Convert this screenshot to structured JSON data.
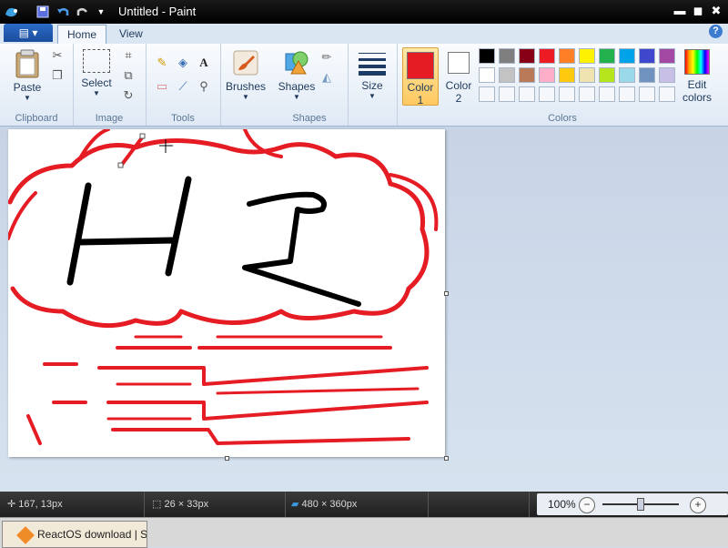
{
  "window": {
    "title": "Untitled - Paint"
  },
  "titlebar_icons": [
    "paint-app-icon",
    "save-icon",
    "undo-icon",
    "redo-icon",
    "quick-access-dropdown-icon"
  ],
  "tabs": [
    {
      "label": "Home"
    },
    {
      "label": "View"
    }
  ],
  "help": "?",
  "groups": {
    "clipboard": {
      "label": "Clipboard",
      "paste": "Paste"
    },
    "image": {
      "label": "Image",
      "select": "Select"
    },
    "tools": {
      "label": "Tools"
    },
    "brushes": {
      "label": "Brushes"
    },
    "shapes": {
      "label": "Shapes",
      "shapes_btn": "Shapes"
    },
    "size": {
      "label": "Size"
    },
    "colors": {
      "label": "Colors",
      "color1": "Color",
      "color1_num": "1",
      "color2": "Color",
      "color2_num": "2",
      "edit": "Edit",
      "edit2": "colors",
      "color1_value": "#e51c23",
      "color2_value": "#ffffff",
      "palette_row1": [
        "#000000",
        "#7f7f7f",
        "#880015",
        "#ed1c24",
        "#ff7f27",
        "#fff200",
        "#22b14c",
        "#00a2e8",
        "#3f48cc",
        "#a349a4"
      ],
      "palette_row2": [
        "#ffffff",
        "#c3c3c3",
        "#b97a57",
        "#ffaec9",
        "#ffc90e",
        "#efe4b0",
        "#b5e61d",
        "#99d9ea",
        "#7092be",
        "#c8bfe7"
      ],
      "palette_row3": [
        "#f5f7fa",
        "#f5f7fa",
        "#f5f7fa",
        "#f5f7fa",
        "#f5f7fa",
        "#f5f7fa",
        "#f5f7fa",
        "#f5f7fa",
        "#f5f7fa",
        "#f5f7fa"
      ]
    }
  },
  "canvas_drawing": {
    "text": "HI",
    "outline_color": "#e51c23",
    "ink_color": "#000000"
  },
  "status": {
    "cursor_pos": "167, 13px",
    "selection_size": "26 × 33px",
    "image_size": "480 × 360px",
    "zoom": "100%",
    "zoom_out": "−",
    "zoom_in": "+",
    "zoom_level": 0.5
  },
  "taskbar": {
    "item": "ReactOS download | So"
  }
}
